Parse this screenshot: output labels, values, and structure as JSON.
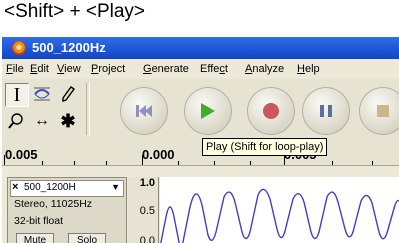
{
  "caption": "<Shift> + <Play>",
  "window": {
    "title": "500_1200Hz"
  },
  "menu": [
    {
      "pre": "",
      "u": "F",
      "post": "ile"
    },
    {
      "pre": "",
      "u": "E",
      "post": "dit"
    },
    {
      "pre": "",
      "u": "V",
      "post": "iew"
    },
    {
      "pre": "",
      "u": "P",
      "post": "roject"
    },
    {
      "pre": "",
      "u": "G",
      "post": "enerate"
    },
    {
      "pre": "Effe",
      "u": "c",
      "post": "t"
    },
    {
      "pre": "",
      "u": "A",
      "post": "nalyze"
    },
    {
      "pre": "",
      "u": "H",
      "post": "elp"
    }
  ],
  "tools": {
    "selection": "I",
    "envelope": "envelope-icon",
    "draw": "pencil-icon",
    "zoom": "magnifier-icon",
    "timeshift": "↔",
    "multi": "✱"
  },
  "transport": [
    "skip-to-start",
    "play",
    "record",
    "pause",
    "stop"
  ],
  "colors": {
    "play": "#3fae2e",
    "record": "#c9575c",
    "pause": "#5b6c9e",
    "skip": "#8f8fc4",
    "stop": "#c9b98a",
    "waveform": "#3d3fc9"
  },
  "ruler": {
    "left": "0.005",
    "mid": "0.000",
    "right": "0.005"
  },
  "tooltip": "Play (Shift for loop-play)",
  "track": {
    "name": "500_1200H",
    "info1": "Stereo, 11025Hz",
    "info2": "32-bit float",
    "mute": "Mute",
    "solo": "Solo"
  },
  "amplitude": {
    "top": "1.0",
    "mid": "0.5",
    "low": "0.0"
  }
}
